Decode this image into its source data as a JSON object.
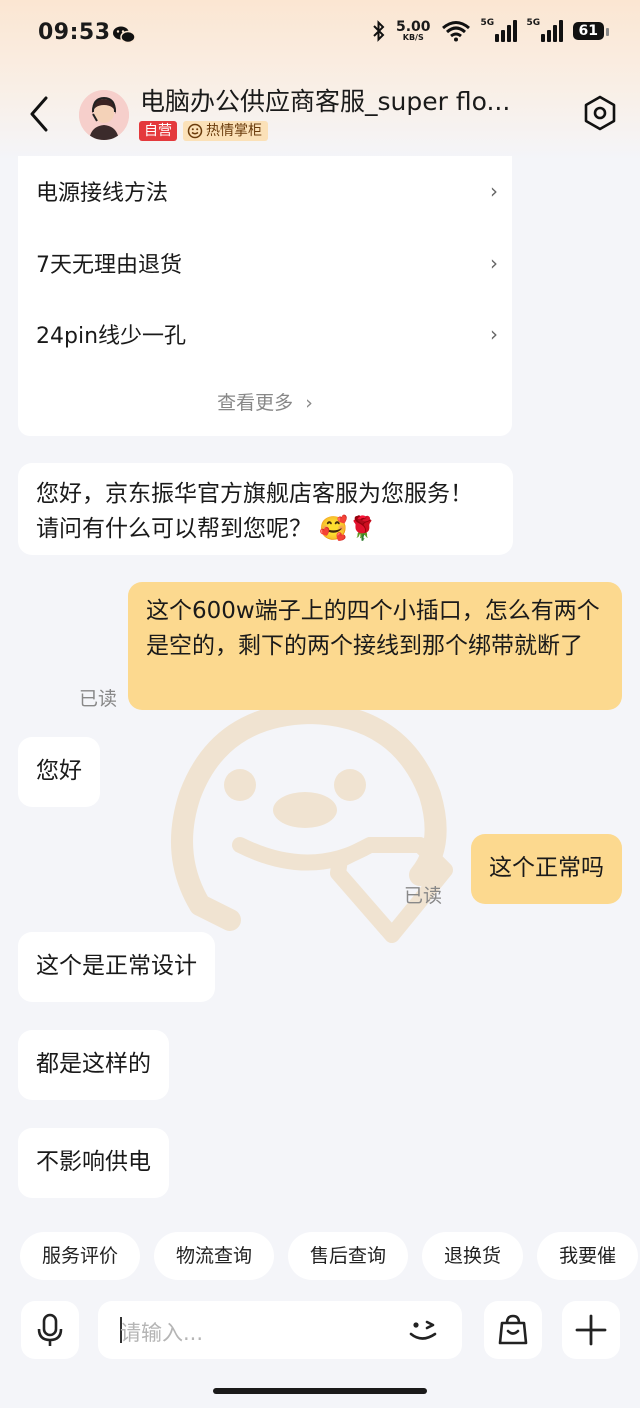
{
  "status_bar": {
    "time": "09:53",
    "speed_value": "5.00",
    "speed_unit": "KB/S",
    "network1": "5G",
    "network2": "5G",
    "battery": "61"
  },
  "header": {
    "shop_name": "电脑办公供应商客服_super flo...",
    "tag_self": "自营",
    "tag_hot": "热情掌柜"
  },
  "faq": {
    "items": [
      {
        "label": "电源接线方法"
      },
      {
        "label": "7天无理由退货"
      },
      {
        "label": "24pin线少一孔"
      }
    ],
    "more_label": "查看更多"
  },
  "messages": [
    {
      "side": "in",
      "text": "您好，京东振华官方旗舰店客服为您服务！请问有什么可以帮到您呢？",
      "emoji": "🥰🌹"
    },
    {
      "side": "out",
      "text": "这个600w端子上的四个小插口，怎么有两个是空的，剩下的两个接线到那个绑带就断了",
      "status": "已读"
    },
    {
      "side": "in",
      "text": "您好"
    },
    {
      "side": "out",
      "text": "这个正常吗",
      "status": "已读"
    },
    {
      "side": "in",
      "text": "这个是正常设计"
    },
    {
      "side": "in",
      "text": "都是这样的"
    },
    {
      "side": "in",
      "text": "不影响供电"
    }
  ],
  "quick_replies": [
    "服务评价",
    "物流查询",
    "售后查询",
    "退换货",
    "我要催"
  ],
  "input": {
    "placeholder": "请输入..."
  },
  "colors": {
    "outgoing_bubble": "#fcd98f",
    "incoming_bubble": "#ffffff",
    "tag_self_bg": "#e4393c",
    "tag_hot_bg": "#fbe1b8"
  }
}
